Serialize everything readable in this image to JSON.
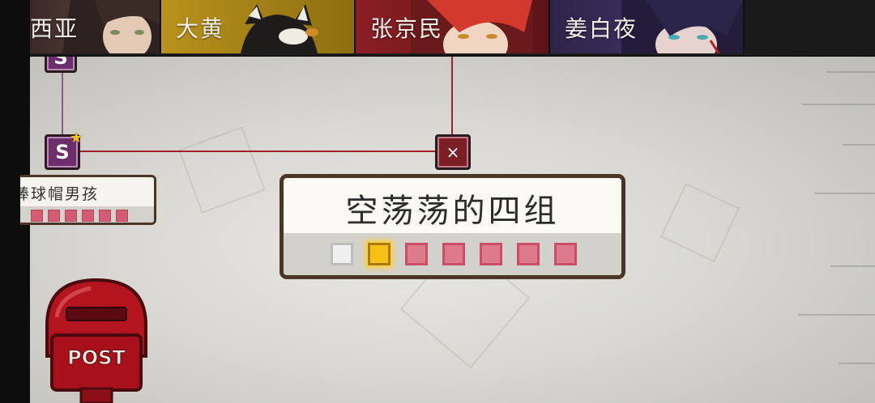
{
  "character_tabs": [
    {
      "label": "西亚",
      "color": "#5a3b38"
    },
    {
      "label": "大黄",
      "color": "#a68416"
    },
    {
      "label": "张京民",
      "color": "#7a1f22"
    },
    {
      "label": "姜白夜",
      "color": "#3d2a5e"
    }
  ],
  "nodes": {
    "top_node_letter": "S",
    "main_node_letter": "S",
    "close_node_symbol": "×"
  },
  "side_card": {
    "title": "棒球帽男孩",
    "squares_count": 6
  },
  "dialog": {
    "title": "空荡荡的四组",
    "squares": [
      "empty",
      "current",
      "pending",
      "pending",
      "pending",
      "pending",
      "pending"
    ]
  },
  "mailbox": {
    "label": "POST"
  },
  "colors": {
    "accent_red": "#a31f2a",
    "node_purple": "#6e2d6b",
    "highlight_gold": "#f6c117",
    "pending_pink": "#dd7a8b"
  }
}
